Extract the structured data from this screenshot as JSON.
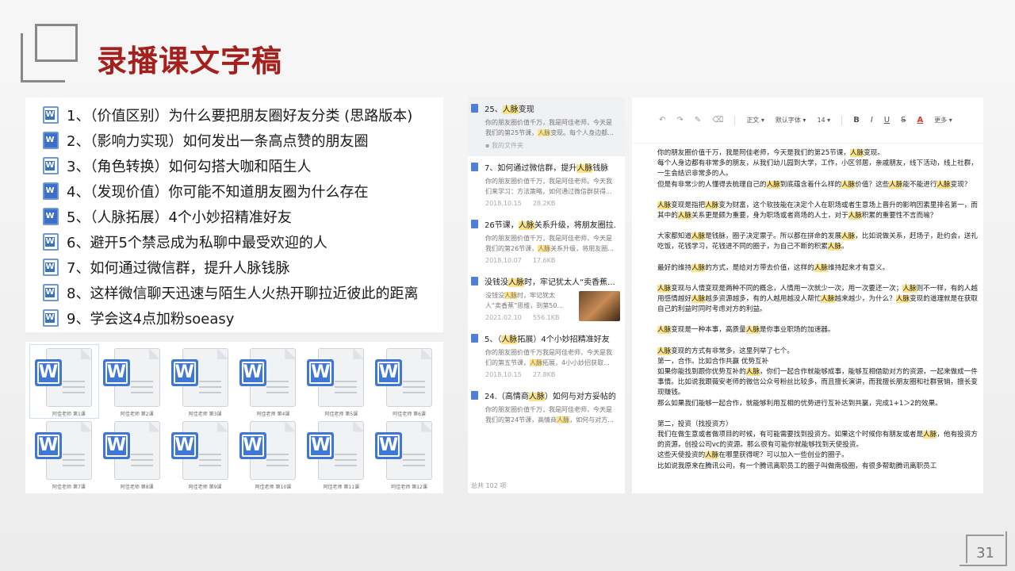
{
  "slide": {
    "title": "录播课文字稿",
    "page_number": "31"
  },
  "course_list": [
    "1、（价值区别）为什么要把朋友圈好友分类 (思路版本)",
    "2、（影响力实现）如何发出一条高点赞的朋友圈",
    "3、（角色转换）如何勾搭大咖和陌生人",
    "4、（发现价值）你可能不知道朋友圈为什么存在",
    "5、（人脉拓展）4个小妙招精准好友",
    "6、避开5个禁忌成为私聊中最受欢迎的人",
    "7、如何通过微信群，提升人脉钱脉",
    "8、这样微信聊天迅速与陌生人火热开聊拉近彼此的距离",
    "9、学会这4点加粉soeasy"
  ],
  "file_grid": {
    "labels": [
      "阿佳老师 第1课",
      "阿佳老师 第2课",
      "阿佳老师 第3课",
      "阿佳老师 第4课",
      "阿佳老师 第5课",
      "阿佳老师 第6课",
      "阿佳老师 第7课",
      "阿佳老师 第8课",
      "阿佳老师 第9课",
      "阿佳老师 第10课",
      "阿佳老师 第11课",
      "阿佳老师 第12课"
    ]
  },
  "doc_list": {
    "items": [
      {
        "title_pre": "25、",
        "title_hl": "人脉",
        "title_post": "变现",
        "snippet_pre": "你的朋友圈价值千万，我是阿佳老师，今天是我们的第25节课，",
        "snippet_hl": "人脉",
        "snippet_post": "变现。每个人身边都...",
        "folder": "我的文件夹",
        "date": "",
        "size": ""
      },
      {
        "title_pre": "7、如何通过微信群，提升",
        "title_hl": "人脉",
        "title_post": "钱脉",
        "snippet_pre": "你的朋友圈价值千万，我是阿佳老师。今天我们来学习：方法策略，如何通过微信群获得...",
        "snippet_hl": "",
        "snippet_post": "",
        "folder": "",
        "date": "2018.10.15",
        "size": "28.2KB"
      },
      {
        "title_pre": "26节课，",
        "title_hl": "人脉",
        "title_post": "关系升级，将朋友圈拉...",
        "snippet_pre": "你的朋友圈价值千万，我是阿佳老师，今天是我们的第26节课，",
        "snippet_hl": "人脉",
        "snippet_post": "关系升级，将朋友圈...",
        "folder": "",
        "date": "2018.10.07",
        "size": "17.6KB"
      },
      {
        "title_pre": "没钱没",
        "title_hl": "人脉",
        "title_post": "时，牢记犹太人“卖香蕉...",
        "snippet_pre": "没钱没",
        "snippet_hl": "人脉",
        "snippet_post": "时，牢记犹太人“卖香蕉”思维，到第50...",
        "folder": "",
        "date": "2021.02.10",
        "size": "556.1KB"
      },
      {
        "title_pre": "5、（",
        "title_hl": "人脉",
        "title_post": "拓展）4个小妙招精准好友",
        "snippet_pre": "你的朋友圈价值千万我是阿佳老师，今天是我们的第五节课，",
        "snippet_hl": "人脉",
        "snippet_post": "拓展，4小小妙招获取...",
        "folder": "",
        "date": "2018.10.15",
        "size": "27.8KB"
      },
      {
        "title_pre": "24.（高情商",
        "title_hl": "人脉",
        "title_post": "）如何与对方妥帖的...",
        "snippet_pre": "你的朋友圈价值千万，我是阿佳老师，今天是我们的第24节课，高情商",
        "snippet_hl": "人脉",
        "snippet_post": "，如何与对方...",
        "folder": "",
        "date": "",
        "size": ""
      }
    ],
    "total": "总共 102 项"
  },
  "editor": {
    "toolbar": {
      "style": "正文",
      "font": "默认字体",
      "size": "14",
      "more": "更多"
    }
  }
}
